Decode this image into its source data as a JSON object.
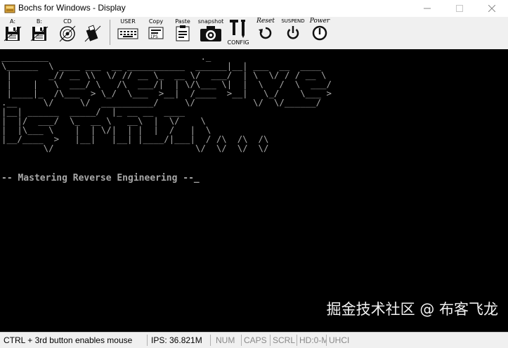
{
  "window": {
    "title": "Bochs for Windows - Display"
  },
  "toolbar": {
    "buttons": [
      {
        "id": "floppy-a",
        "label": "A:",
        "icon": "floppy-icon"
      },
      {
        "id": "floppy-b",
        "label": "B:",
        "icon": "floppy-icon"
      },
      {
        "id": "cdrom",
        "label": "CD",
        "icon": "cdrom-icon"
      },
      {
        "id": "usb",
        "label": "",
        "icon": "usb-drive-icon"
      },
      {
        "id": "user",
        "label": "USER",
        "icon": "keyboard-icon"
      },
      {
        "id": "copy",
        "label": "Copy",
        "icon": "copy-icon"
      },
      {
        "id": "paste",
        "label": "Paste",
        "icon": "paste-icon"
      },
      {
        "id": "snapshot",
        "label": "snapshot",
        "icon": "camera-icon"
      },
      {
        "id": "config",
        "label": "CONFIG",
        "icon": "config-icon"
      },
      {
        "id": "reset",
        "label": "Reset",
        "icon": "reset-icon"
      },
      {
        "id": "suspend",
        "label": "SUSPEND",
        "icon": "suspend-icon"
      },
      {
        "id": "power",
        "label": "Power",
        "icon": "power-icon"
      }
    ]
  },
  "screen": {
    "ascii_art": "_________                             ._\n\\______  \\ ____ ___  __ ___________  ______|__| ___  __  ____\n |       _// __ \\\\  \\/ // __ \\_  __ \\/  ___/  | \\  \\/ / / __ \\\n |    |   \\  ___/ \\   /\\  ___/|  | \\/\\___ \\|  |  \\   /  \\  ___/\n |____|_  /\\___  > \\_/  \\___  >__|  /____  >__|   \\_/    \\___ >\n.__     \\/     \\/  __________/     \\/           \\/  \\/______/\n|__| ______  _____/  |_ __ __  ____\n|  |/  ___/  \\_  __ \\   __\\  |  \\/    \\\n|  |\\___ \\    |  | \\/|  | |  |  /   |  \\\n|__/____  >   |__|   |__| |____/|___|  / /\\  /\\  /\\\n        \\/                           \\/  \\/  \\/  \\/",
    "tagline": "-- Mastering Reverse Engineering --_"
  },
  "statusbar": {
    "mouse_hint": "CTRL + 3rd button enables mouse",
    "ips": "IPS: 36.821M",
    "num": "NUM",
    "caps": "CAPS",
    "scrl": "SCRL",
    "hd": "HD:0-M",
    "uhci": "UHCI"
  },
  "watermark": {
    "text": "掘金技术社区 @ 布客飞龙"
  },
  "colors": {
    "screen_bg": "#000000",
    "screen_fg": "#a8a8a8",
    "toolbar_bg": "#f0f0f0"
  }
}
